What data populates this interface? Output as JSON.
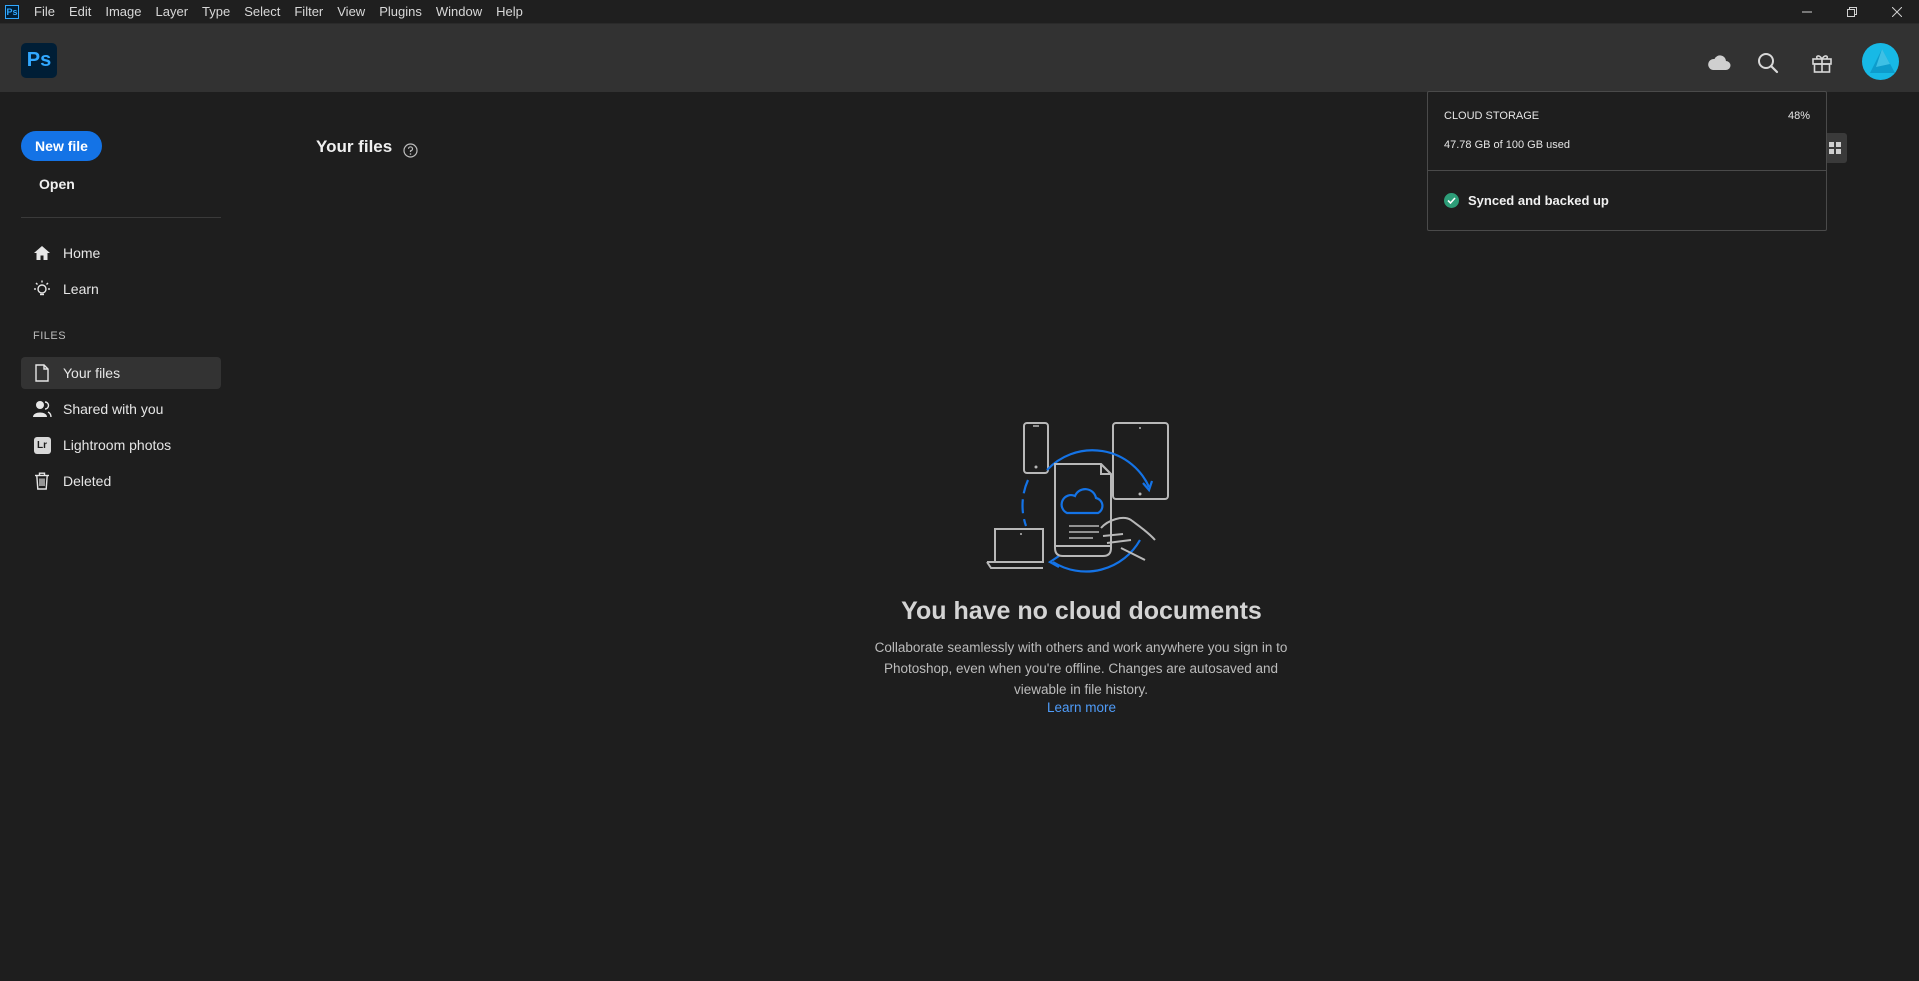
{
  "menubar": {
    "app_icon_label": "Ps",
    "items": [
      "File",
      "Edit",
      "Image",
      "Layer",
      "Type",
      "Select",
      "Filter",
      "View",
      "Plugins",
      "Window",
      "Help"
    ]
  },
  "header": {
    "logo_text": "Ps",
    "icons": [
      "cloud-icon",
      "search-icon",
      "gift-icon"
    ]
  },
  "sidebar": {
    "new_file_label": "New file",
    "open_label": "Open",
    "nav": [
      {
        "label": "Home",
        "icon": "home-icon"
      },
      {
        "label": "Learn",
        "icon": "lightbulb-icon"
      }
    ],
    "files_section_label": "FILES",
    "files": [
      {
        "label": "Your files",
        "icon": "file-icon",
        "active": true
      },
      {
        "label": "Shared with you",
        "icon": "shared-users-icon"
      },
      {
        "label": "Lightroom photos",
        "icon": "lightroom-icon",
        "icon_text": "Lr"
      },
      {
        "label": "Deleted",
        "icon": "trash-icon"
      }
    ]
  },
  "main": {
    "title": "Your files",
    "empty": {
      "heading": "You have no cloud documents",
      "body": "Collaborate seamlessly with others and work anywhere you sign in to Photoshop, even when you're offline. Changes are autosaved and viewable in file history.",
      "link": "Learn more"
    }
  },
  "storage_popover": {
    "label": "CLOUD STORAGE",
    "percent": "48%",
    "used_text": "47.78 GB of 100 GB used",
    "status": "Synced and backed up"
  },
  "colors": {
    "accent": "#1473e6",
    "link": "#4f9cf9",
    "ps_blue": "#31a8ff",
    "success": "#2d9d78"
  }
}
